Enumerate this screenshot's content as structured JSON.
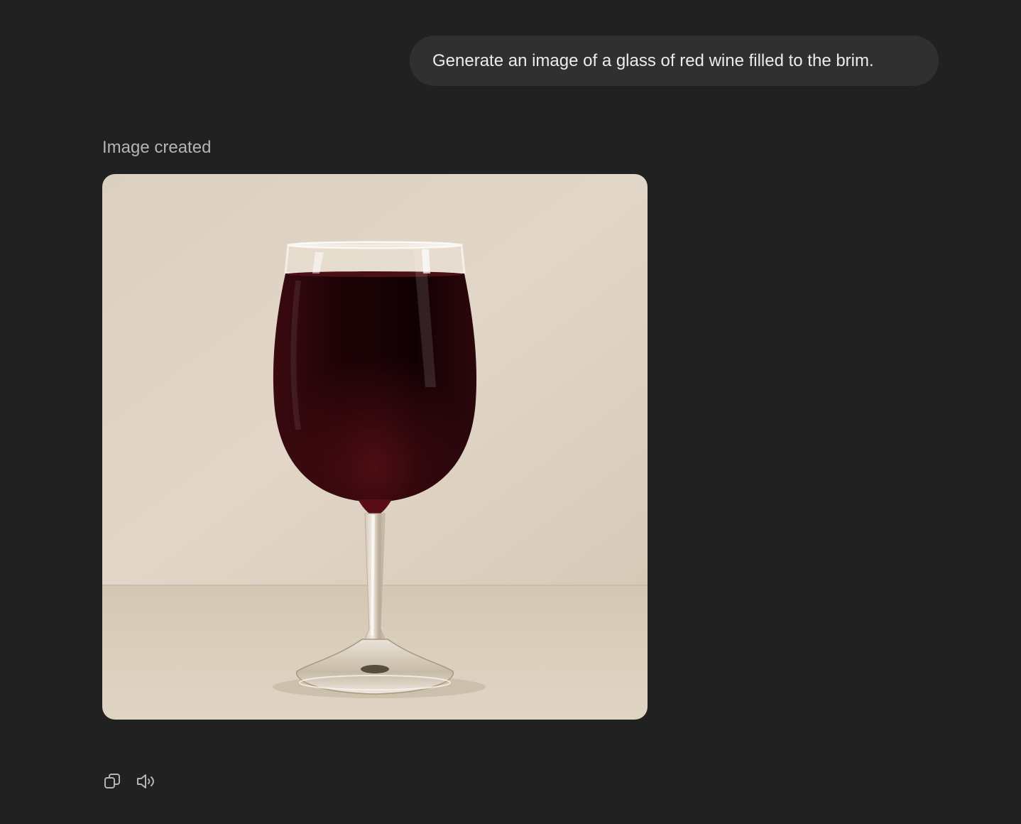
{
  "conversation": {
    "user_message": "Generate an image of a glass of red wine filled to the brim.",
    "assistant": {
      "status_label": "Image created",
      "image_alt": "A glass of red wine on a beige background"
    }
  },
  "actions": [
    {
      "name": "copy-button",
      "icon": "copy-icon"
    },
    {
      "name": "read-aloud-button",
      "icon": "speaker-icon"
    }
  ],
  "colors": {
    "background": "#212121",
    "user_bubble": "#303030",
    "text_primary": "#ececec",
    "text_secondary": "#b4b4b4",
    "wine": "#2a0508",
    "backdrop": "#dcd0c1"
  }
}
